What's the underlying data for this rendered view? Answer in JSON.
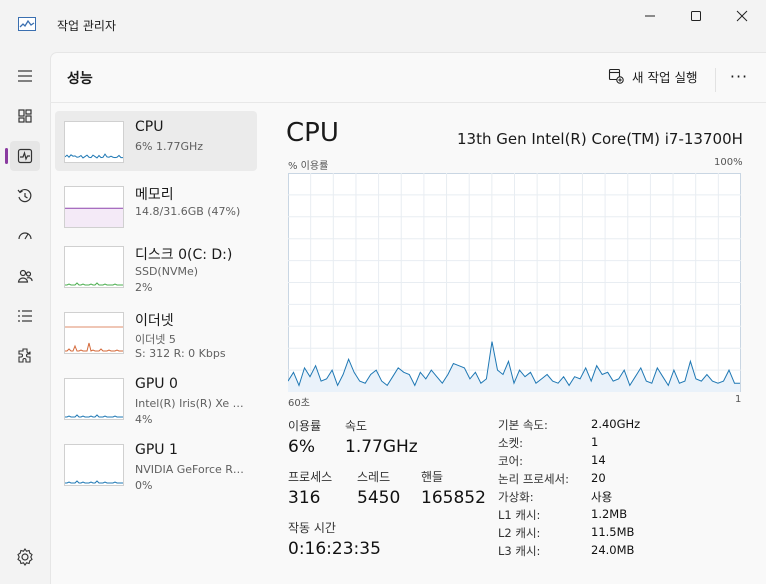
{
  "window": {
    "title": "작업 관리자"
  },
  "header": {
    "page_title": "성능",
    "new_task_label": "새 작업 실행",
    "more_label": "···"
  },
  "nav": {
    "icons": [
      "hamburger-icon",
      "processes-icon",
      "performance-icon",
      "app-history-icon",
      "startup-icon",
      "users-icon",
      "details-icon",
      "services-icon"
    ],
    "settings_icon": "gear-icon"
  },
  "devices": [
    {
      "name": "CPU",
      "sub1": "6% 1.77GHz",
      "sub2": "",
      "sub3": "",
      "graph_color": "#1f78b4",
      "selected": true
    },
    {
      "name": "메모리",
      "sub1": "14.8/31.6GB (47%)",
      "sub2": "",
      "sub3": "",
      "graph_color": "#8e44ad",
      "usage": 0.47
    },
    {
      "name": "디스크 0(C: D:)",
      "sub1": "SSD(NVMe)",
      "sub2": "2%",
      "sub3": "",
      "graph_color": "#4caf50"
    },
    {
      "name": "이더넷",
      "sub1": "이더넷 5",
      "sub2": "S: 312  R: 0 Kbps",
      "sub3": "",
      "graph_color": "#d4693a"
    },
    {
      "name": "GPU 0",
      "sub1": "Intel(R) Iris(R) Xe …",
      "sub2": "4%",
      "sub3": "",
      "graph_color": "#1f78b4"
    },
    {
      "name": "GPU 1",
      "sub1": "NVIDIA GeForce R…",
      "sub2": "0%",
      "sub3": "",
      "graph_color": "#1f78b4"
    }
  ],
  "main": {
    "title": "CPU",
    "model": "13th Gen Intel(R) Core(TM) i7-13700H",
    "usage_label": "% 이용률",
    "max_label": "100%",
    "time_label": "60초",
    "min_label": "1",
    "stats": {
      "util_label": "이용률",
      "util_value": "6%",
      "speed_label": "속도",
      "speed_value": "1.77GHz",
      "proc_label": "프로세스",
      "proc_value": "316",
      "thread_label": "스레드",
      "thread_value": "5450",
      "handle_label": "핸들",
      "handle_value": "165852",
      "uptime_label": "작동 시간",
      "uptime_value": "0:16:23:35"
    },
    "info": [
      {
        "k": "기본 속도:",
        "v": "2.40GHz"
      },
      {
        "k": "소켓:",
        "v": "1"
      },
      {
        "k": "코어:",
        "v": "14"
      },
      {
        "k": "논리 프로세서:",
        "v": "20"
      },
      {
        "k": "가상화:",
        "v": "사용"
      },
      {
        "k": "L1 캐시:",
        "v": "1.2MB"
      },
      {
        "k": "L2 캐시:",
        "v": "11.5MB"
      },
      {
        "k": "L3 캐시:",
        "v": "24.0MB"
      }
    ]
  },
  "chart_data": {
    "type": "area",
    "ylim": [
      0,
      100
    ],
    "xlabel": "60초",
    "grid": true,
    "values": [
      5,
      9,
      3,
      11,
      7,
      12,
      5,
      6,
      10,
      3,
      8,
      15,
      9,
      5,
      4,
      8,
      10,
      5,
      3,
      7,
      11,
      9,
      8,
      3,
      9,
      6,
      10,
      7,
      4,
      8,
      13,
      12,
      11,
      6,
      9,
      4,
      6,
      23,
      10,
      8,
      14,
      4,
      10,
      7,
      9,
      4,
      6,
      8,
      5,
      4,
      7,
      3,
      7,
      6,
      11,
      5,
      12,
      8,
      9,
      5,
      6,
      10,
      3,
      7,
      11,
      5,
      4,
      11,
      7,
      3,
      10,
      4,
      5,
      14,
      6,
      5,
      8,
      5,
      4,
      5,
      10,
      4,
      4
    ]
  }
}
